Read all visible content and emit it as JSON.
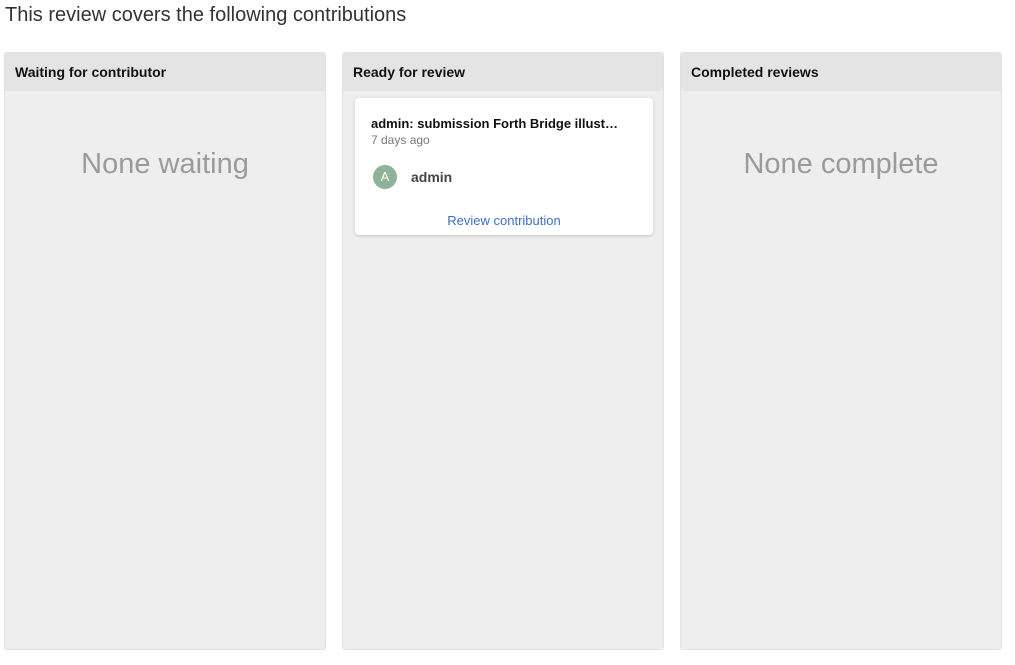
{
  "page": {
    "heading": "This review covers the following contributions"
  },
  "columns": [
    {
      "title": "Waiting for contributor",
      "empty_message": "None waiting"
    },
    {
      "title": "Ready for review",
      "cards": [
        {
          "title": "admin: submission Forth Bridge illust…",
          "time": "7 days ago",
          "avatar_initial": "A",
          "avatar_color": "#8fb39a",
          "user": "admin",
          "action": "Review contribution"
        }
      ]
    },
    {
      "title": "Completed reviews",
      "empty_message": "None complete"
    }
  ],
  "colors": {
    "column_bg": "#eeeeee",
    "header_bg": "#e4e4e4",
    "link": "#3f6fc4",
    "empty_text": "#9b9b9b"
  }
}
